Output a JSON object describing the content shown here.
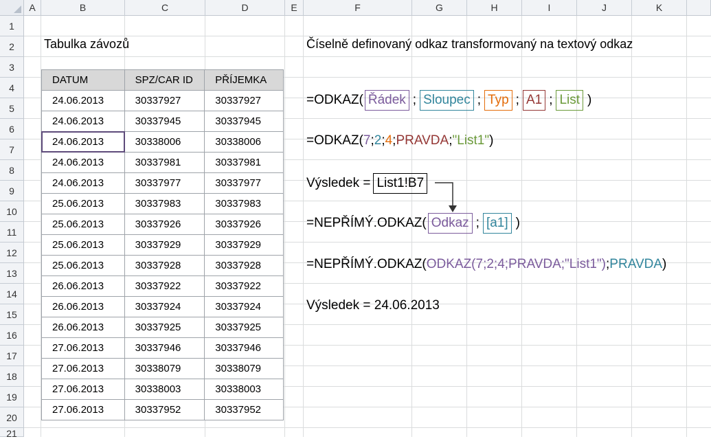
{
  "columns": [
    "A",
    "B",
    "C",
    "D",
    "E",
    "F",
    "G",
    "H",
    "I",
    "J",
    "K"
  ],
  "rows": [
    "1",
    "2",
    "3",
    "4",
    "5",
    "6",
    "7",
    "8",
    "9",
    "10",
    "11",
    "12",
    "13",
    "14",
    "15",
    "16",
    "17",
    "18",
    "19",
    "20",
    "21"
  ],
  "left_title": "Tabulka závozů",
  "right_title": "Číselně definovaný odkaz transformovaný na textový odkaz",
  "table": {
    "headers": [
      "DATUM",
      "SPZ/CAR ID",
      "PŘÍJEMKA"
    ],
    "rows": [
      [
        "24.06.2013",
        "30337927",
        "30337927"
      ],
      [
        "24.06.2013",
        "30337945",
        "30337945"
      ],
      [
        "24.06.2013",
        "30338006",
        "30338006"
      ],
      [
        "24.06.2013",
        "30337981",
        "30337981"
      ],
      [
        "24.06.2013",
        "30337977",
        "30337977"
      ],
      [
        "25.06.2013",
        "30337983",
        "30337983"
      ],
      [
        "25.06.2013",
        "30337926",
        "30337926"
      ],
      [
        "25.06.2013",
        "30337929",
        "30337929"
      ],
      [
        "25.06.2013",
        "30337928",
        "30337928"
      ],
      [
        "26.06.2013",
        "30337922",
        "30337922"
      ],
      [
        "26.06.2013",
        "30337924",
        "30337924"
      ],
      [
        "26.06.2013",
        "30337925",
        "30337925"
      ],
      [
        "27.06.2013",
        "30337946",
        "30337946"
      ],
      [
        "27.06.2013",
        "30338079",
        "30338079"
      ],
      [
        "27.06.2013",
        "30338003",
        "30338003"
      ],
      [
        "27.06.2013",
        "30337952",
        "30337952"
      ]
    ]
  },
  "formula1": {
    "prefix": "=ODKAZ(",
    "radek": "Řádek",
    "sloupec": "Sloupec",
    "typ": "Typ",
    "a1": "A1",
    "list": "List",
    "suffix": ")",
    "sep": ";"
  },
  "formula2": {
    "prefix": "=ODKAZ(",
    "v7": "7",
    "v2": "2",
    "v4": "4",
    "pravda": "PRAVDA",
    "list1": "\"List1\"",
    "suffix": ")",
    "sep": ";"
  },
  "result1": {
    "label": "Výsledek =",
    "value": "List1!B7"
  },
  "formula3": {
    "prefix": "=NEPŘÍMÝ.ODKAZ(",
    "odkaz": "Odkaz",
    "a1": "[a1]",
    "suffix": ")",
    "sep": ";"
  },
  "formula4": {
    "prefix": "=NEPŘÍMÝ.ODKAZ(",
    "inner": "ODKAZ(7;2;4;PRAVDA;\"List1\")",
    "sep": ";",
    "pravda": "PRAVDA",
    "suffix": ")"
  },
  "result2": "Výsledek = 24.06.2013",
  "colors": {
    "selection": "#5d4a7a",
    "header_bg": "#d8d8d8",
    "grid": "#dadcdd"
  }
}
